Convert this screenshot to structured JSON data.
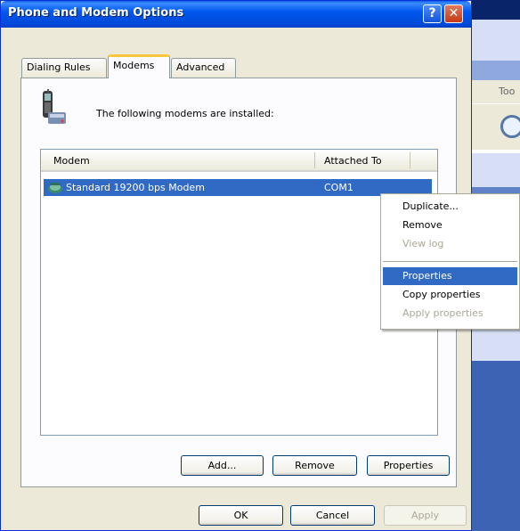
{
  "background": {
    "menu_partial": "Too"
  },
  "dialog": {
    "title": "Phone and Modem Options",
    "help_glyph": "?",
    "close_glyph": "✕",
    "tabs": [
      {
        "label": "Dialing Rules",
        "selected": false
      },
      {
        "label": "Modems",
        "selected": true
      },
      {
        "label": "Advanced",
        "selected": false
      }
    ],
    "intro_text": "The following modems are installed:",
    "list": {
      "columns": [
        "Modem",
        "Attached To"
      ],
      "rows": [
        {
          "modem": "Standard 19200 bps Modem",
          "attached_to": "COM1",
          "selected": true
        }
      ]
    },
    "buttons": {
      "add": "Add...",
      "remove": "Remove",
      "properties": "Properties",
      "ok": "OK",
      "cancel": "Cancel",
      "apply": "Apply"
    }
  },
  "context_menu": {
    "items": [
      {
        "label": "Duplicate...",
        "enabled": true
      },
      {
        "label": "Remove",
        "enabled": true
      },
      {
        "label": "View log",
        "enabled": false
      },
      {
        "label": "Properties",
        "enabled": true,
        "highlighted": true
      },
      {
        "label": "Copy properties",
        "enabled": true
      },
      {
        "label": "Apply properties",
        "enabled": false
      }
    ]
  },
  "colors": {
    "title_bar": "#0058ee",
    "selection": "#316ac5",
    "dialog_face": "#ece9d8"
  }
}
